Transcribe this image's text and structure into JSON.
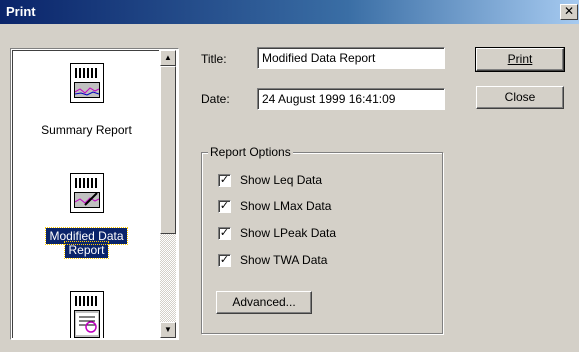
{
  "window": {
    "title": "Print",
    "close_glyph": "✕"
  },
  "report_list": {
    "items": [
      {
        "label": "Summary Report",
        "icon": "summary-report-icon",
        "selected": false
      },
      {
        "label_line1": "Modified Data",
        "label_line2": "Report",
        "icon": "modified-data-report-icon",
        "selected": true
      },
      {
        "label": "",
        "icon": "detail-report-icon",
        "selected": false
      }
    ],
    "scroll_up_glyph": "▲",
    "scroll_down_glyph": "▼"
  },
  "form": {
    "title_label": "Title:",
    "title_value": "Modified Data Report",
    "date_label": "Date:",
    "date_value": "24 August 1999 16:41:09"
  },
  "buttons": {
    "print": "Print",
    "close": "Close",
    "advanced": "Advanced..."
  },
  "report_options": {
    "heading": "Report Options",
    "options": [
      {
        "label": "Show Leq Data",
        "checked": true
      },
      {
        "label": "Show LMax Data",
        "checked": true
      },
      {
        "label": "Show LPeak Data",
        "checked": true
      },
      {
        "label": "Show TWA Data",
        "checked": true
      }
    ],
    "check_glyph": "✓"
  },
  "colors": {
    "titlebar": "#0a246a",
    "face": "#d4d0c8",
    "selection": "#0a246a"
  }
}
